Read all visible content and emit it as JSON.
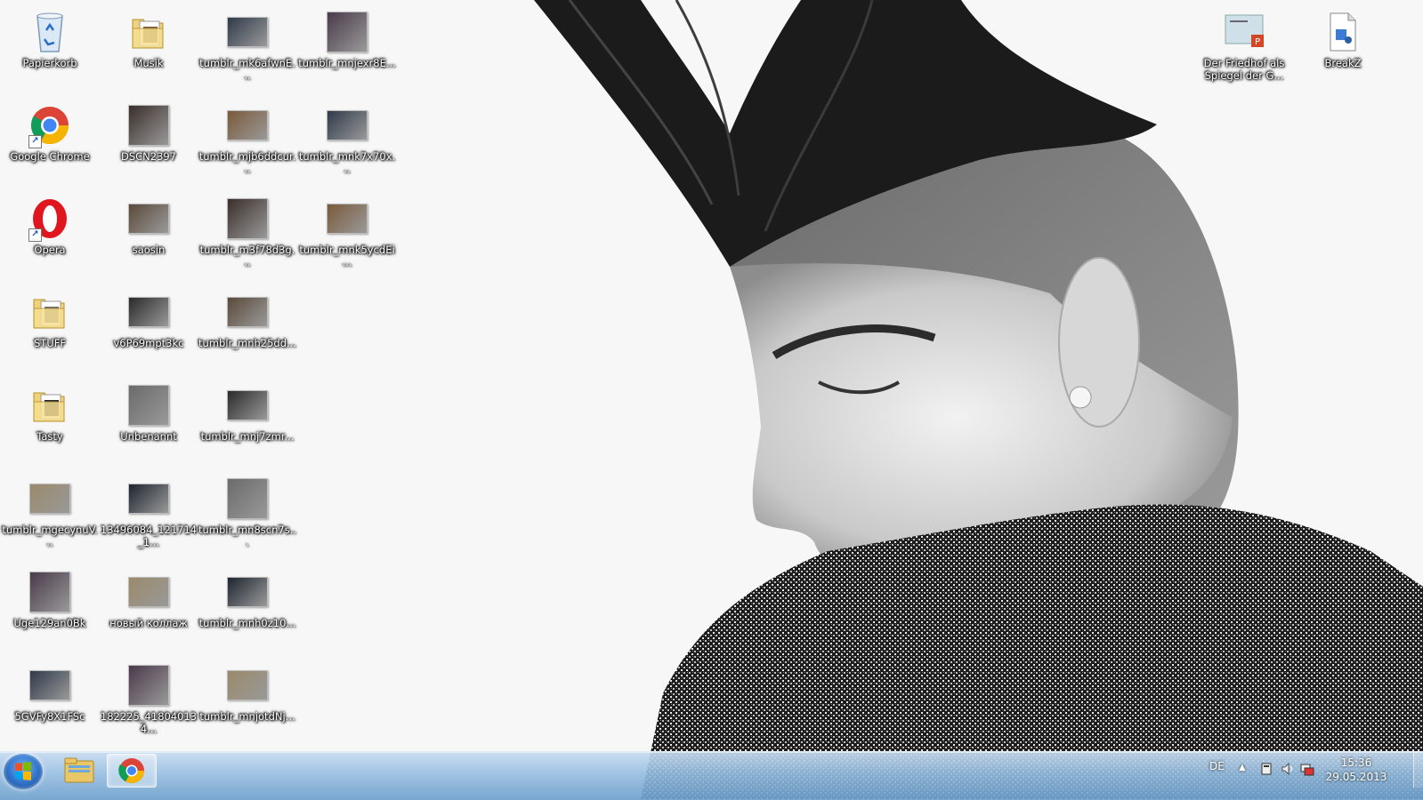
{
  "desktop": {
    "icons": [
      {
        "label": "Papierkorb",
        "kind": "recycle-bin"
      },
      {
        "label": "Google Chrome",
        "kind": "chrome"
      },
      {
        "label": "Opera",
        "kind": "opera"
      },
      {
        "label": "STUFF",
        "kind": "folder"
      },
      {
        "label": "Tasty",
        "kind": "folder"
      },
      {
        "label": "tumblr_mgecynuV...",
        "kind": "image"
      },
      {
        "label": "Uge129an0Bk",
        "kind": "image"
      },
      {
        "label": "5GVFy8X1FSc",
        "kind": "image"
      },
      {
        "label": "Musik",
        "kind": "folder"
      },
      {
        "label": "DSCN2397",
        "kind": "image"
      },
      {
        "label": "saosin",
        "kind": "image"
      },
      {
        "label": "v6P69mpt3kc",
        "kind": "image"
      },
      {
        "label": "Unbenannt",
        "kind": "image"
      },
      {
        "label": "13496084_121714_1...",
        "kind": "image"
      },
      {
        "label": "новый коллаж",
        "kind": "image"
      },
      {
        "label": "182225_418040134...",
        "kind": "image"
      },
      {
        "label": "tumblr_mk6afwnE...",
        "kind": "image"
      },
      {
        "label": "tumblr_mjb6ddcur...",
        "kind": "image"
      },
      {
        "label": "tumblr_m3f78d3g...",
        "kind": "image"
      },
      {
        "label": "tumblr_mnh25dd...",
        "kind": "image"
      },
      {
        "label": "tumblr_mnj7zmr...",
        "kind": "image"
      },
      {
        "label": "tumblr_mn8scn7s...",
        "kind": "image"
      },
      {
        "label": "tumblr_mnh0z10...",
        "kind": "image"
      },
      {
        "label": "tumblr_mnjotdNj...",
        "kind": "image"
      },
      {
        "label": "tumblr_mnjexr8E...",
        "kind": "image"
      },
      {
        "label": "tumblr_mnk7x70x...",
        "kind": "image"
      },
      {
        "label": "tumblr_mnk5ycdEi...",
        "kind": "image"
      },
      {
        "label": "Der Friedhof als Spiegel der G...",
        "kind": "document"
      },
      {
        "label": "BreakZ",
        "kind": "audio"
      }
    ]
  },
  "taskbar": {
    "pinned": [
      "start-button",
      "windows-explorer",
      "google-chrome"
    ],
    "tray": {
      "language": "DE",
      "time": "15:36",
      "date": "29.05.2013"
    }
  },
  "colors": {
    "taskbar_top": "#c8dcf0",
    "taskbar_bottom": "#6ea0cd",
    "label_text": "#ffffff"
  }
}
